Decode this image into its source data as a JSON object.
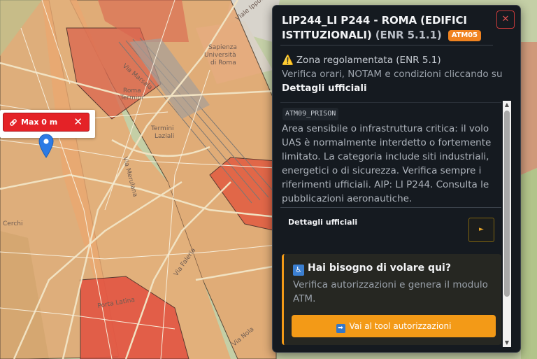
{
  "map": {
    "labels": {
      "sapienza": "Sapienza",
      "universita": "Università",
      "di_roma": "di Roma",
      "roma": "Roma",
      "termini": "Termini",
      "termini2": "Termini",
      "laziali": "Laziali",
      "via_marsala": "Via Marsala",
      "viale_ippocrate": "Viale Ippocrate",
      "via_merulana": "Via Merulana",
      "via_cerchi": "Cerchi",
      "via_faleria": "Via Faleria",
      "via_porta_latina": "Porta Latina",
      "via_nola": "Via Nola"
    },
    "popup": {
      "max_label": "Max 0 m",
      "close": "✕"
    }
  },
  "panel": {
    "title_main": "LIP244_LI P244 - ROMA (EDIFICI ISTITUZIONALI)",
    "title_ref": "(ENR 5.1.1)",
    "badge": "ATM05",
    "close": "✕",
    "notice": {
      "icon": "⚠️",
      "title": "Zona regolamentata (ENR 5.1)",
      "text": "Verifica orari, NOTAM e condizioni cliccando su",
      "strong": "Dettagli ufficiali"
    },
    "code": "ATM09_PRISON",
    "description": "Area sensibile o infrastruttura critica: il volo UAS è normalmente interdetto o fortemente limitato. La categoria include siti industriali, energetici o di sicurezza. Verifica sempre i riferimenti ufficiali. AIP: LI P244. Consulta le pubblicazioni aeronautiche.",
    "details_label": "Dettagli ufficiali",
    "play": "►",
    "help": {
      "icon": "♿",
      "title": "Hai bisogno di volare qui?",
      "text": "Verifica autorizzazioni e genera il modulo ATM.",
      "cta_icon": "➡",
      "cta": "Vai al tool autorizzazioni"
    },
    "scroll_up": "▲",
    "scroll_down": "▼"
  },
  "colors": {
    "zone_orange": "#e8a068",
    "zone_red": "#e05a45",
    "accent": "#f39a17",
    "danger": "#e42227"
  }
}
